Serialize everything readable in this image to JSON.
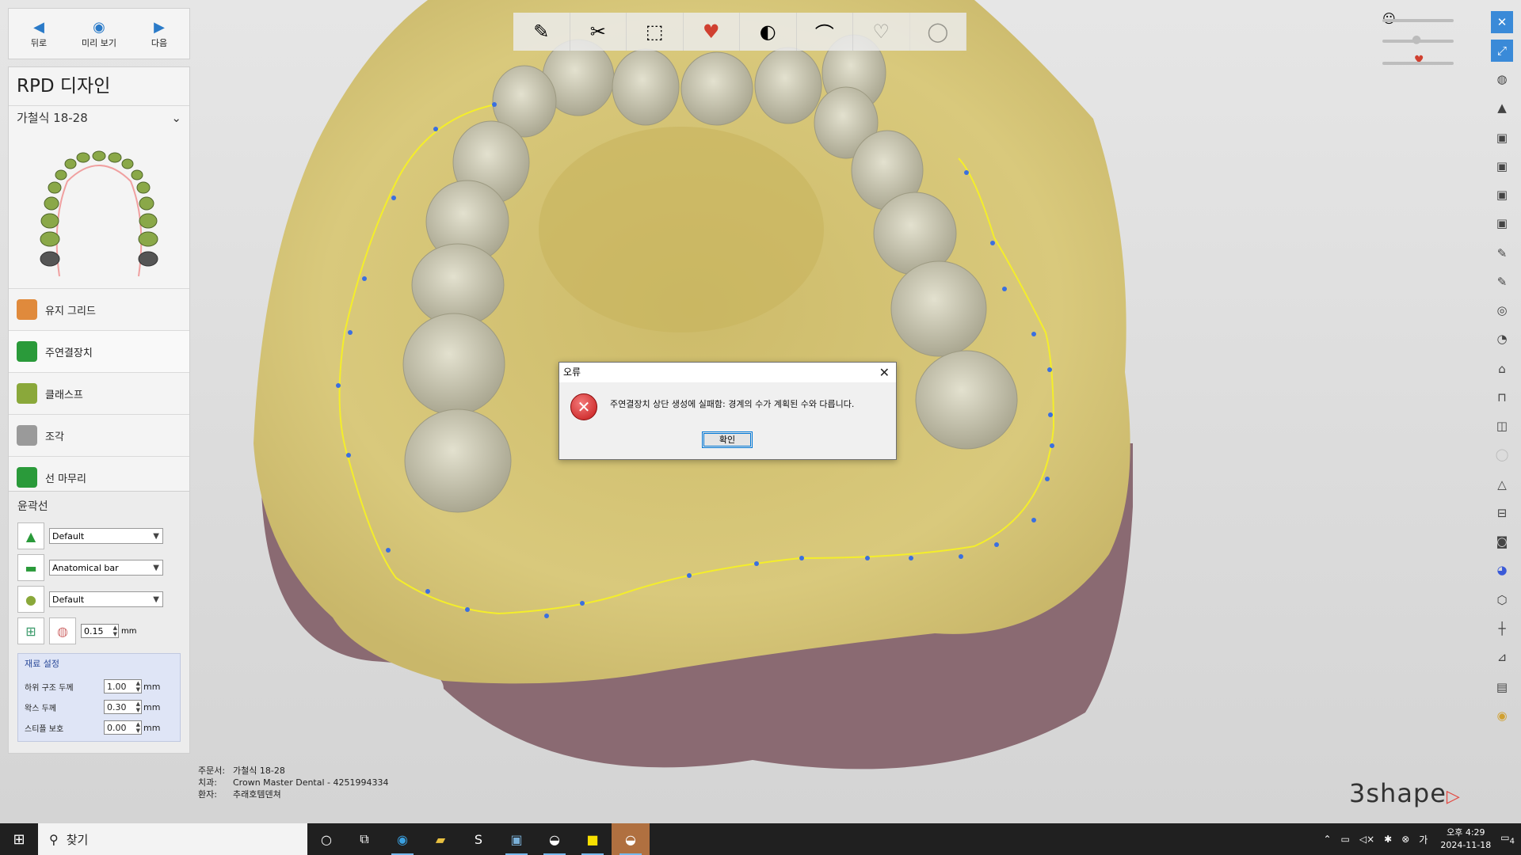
{
  "nav": {
    "back": "뒤로",
    "preview": "미리 보기",
    "next": "다음"
  },
  "panel": {
    "title": "RPD 디자인",
    "case": "가철식 18-28"
  },
  "steps": [
    {
      "label": "유지 그리드",
      "icon": "retention-grid-icon",
      "color": "#e08a3c"
    },
    {
      "label": "주연결장치",
      "icon": "major-connector-icon",
      "color": "#2a9a3a"
    },
    {
      "label": "클래스프",
      "icon": "clasp-icon",
      "color": "#8aa83a"
    },
    {
      "label": "조각",
      "icon": "sculpt-icon",
      "color": "#7a7a7a"
    },
    {
      "label": "선 마무리",
      "icon": "finish-line-icon",
      "color": "#2a9a3a"
    }
  ],
  "outline": {
    "title": "윤곽선",
    "select1": "Default",
    "select2": "Anatomical bar",
    "select3": "Default",
    "offset_value": "0.15",
    "unit": "mm",
    "material_title": "재료 설정",
    "materials": [
      {
        "label": "하위 구조 두께",
        "value": "1.00",
        "unit": "mm"
      },
      {
        "label": "왁스 두께",
        "value": "0.30",
        "unit": "mm"
      },
      {
        "label": "스티플 보호",
        "value": "0.00",
        "unit": "mm"
      }
    ]
  },
  "dialog": {
    "title": "오류",
    "message": "주연결장치 상단 생성에 실패함: 경계의 수가 계획된 수와 다릅니다.",
    "ok": "확인"
  },
  "info": {
    "order_key": "주문서:",
    "order_val": "가철식 18-28",
    "lab_key": "치과:",
    "lab_val": "Crown Master Dental - 4251994334",
    "patient_key": "환자:",
    "patient_val": "추래호템덴쳐"
  },
  "brand": "3shape",
  "taskbar": {
    "search_placeholder": "찾기",
    "time": "오후 4:29",
    "date": "2024-11-18",
    "notifications": "4"
  },
  "colors": {
    "model": "#d8c878",
    "base": "#8a6a72",
    "outline": "#f4ee2a",
    "accent": "#2a7ac8"
  }
}
